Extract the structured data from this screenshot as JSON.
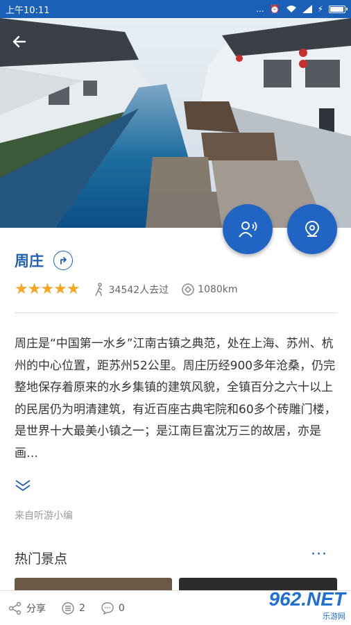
{
  "statusbar": {
    "time": "上午10:11",
    "signal_text": "...",
    "icons": [
      "alarm-icon",
      "wifi-icon",
      "signal-icon",
      "charge-icon",
      "battery-icon"
    ]
  },
  "header": {
    "back_icon": "back-arrow-icon"
  },
  "hero": {
    "image_desc": "water-town-canal-photo"
  },
  "fabs": [
    {
      "name": "audio-guide",
      "icon": "listener-icon"
    },
    {
      "name": "map-location",
      "icon": "map-pin-icon"
    }
  ],
  "spot": {
    "title": "周庄",
    "rating_stars": 5,
    "visitors": "34542人去过",
    "distance": "1080km"
  },
  "description": {
    "text": "周庄是“中国第一水乡”江南古镇之典范，处在上海、苏州、杭州的中心位置，距苏州52公里。周庄历经900多年沧桑，仍完整地保存着原来的水乡集镇的建筑风貌，全镇百分之六十以上的民居仍为明清建筑，有近百座古典宅院和60多个砖雕门楼，是世界十大最美小镇之一；是江南巨富沈万三的故居，亦是画…",
    "source": "来自听游小编"
  },
  "hot_spots": {
    "title": "热门景点",
    "more": "···"
  },
  "bottombar": {
    "share_label": "分享",
    "comments_count": "2",
    "messages_count": "0"
  },
  "watermark": {
    "logo": "962.NET",
    "sub": "乐游网"
  },
  "colors": {
    "primary": "#1f5fb4",
    "star": "#f5a623",
    "statusbar": "#1a5fb8"
  }
}
